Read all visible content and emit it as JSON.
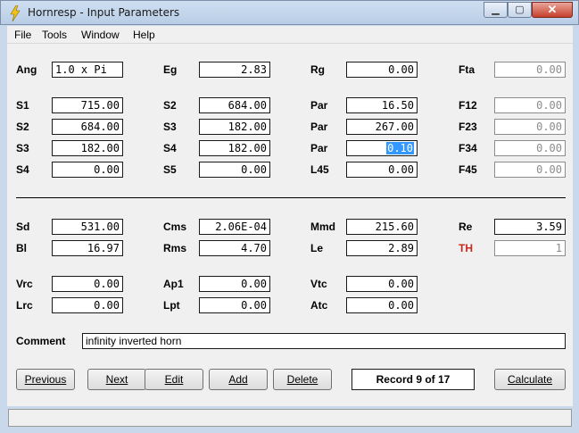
{
  "window": {
    "title": "Hornresp - Input Parameters",
    "min": "▁",
    "max": "▢",
    "close": "✕"
  },
  "menu": [
    "File",
    "Tools",
    "Window",
    "Help"
  ],
  "params": {
    "ang": {
      "label": "Ang",
      "value": "1.0 x Pi"
    },
    "eg": {
      "label": "Eg",
      "value": "2.83"
    },
    "rg": {
      "label": "Rg",
      "value": "0.00"
    },
    "fta": {
      "label": "Fta",
      "value": "0.00"
    },
    "s1": {
      "label": "S1",
      "value": "715.00"
    },
    "s2a": {
      "label": "S2",
      "value": "684.00"
    },
    "par1": {
      "label": "Par",
      "value": "16.50"
    },
    "f12": {
      "label": "F12",
      "value": "0.00"
    },
    "s2b": {
      "label": "S2",
      "value": "684.00"
    },
    "s3a": {
      "label": "S3",
      "value": "182.00"
    },
    "par2": {
      "label": "Par",
      "value": "267.00"
    },
    "f23": {
      "label": "F23",
      "value": "0.00"
    },
    "s3b": {
      "label": "S3",
      "value": "182.00"
    },
    "s4a": {
      "label": "S4",
      "value": "182.00"
    },
    "par3": {
      "label": "Par",
      "value": "0.10"
    },
    "f34": {
      "label": "F34",
      "value": "0.00"
    },
    "s4b": {
      "label": "S4",
      "value": "0.00"
    },
    "s5": {
      "label": "S5",
      "value": "0.00"
    },
    "l45": {
      "label": "L45",
      "value": "0.00"
    },
    "f45": {
      "label": "F45",
      "value": "0.00"
    },
    "sd": {
      "label": "Sd",
      "value": "531.00"
    },
    "cms": {
      "label": "Cms",
      "value": "2.06E-04"
    },
    "mmd": {
      "label": "Mmd",
      "value": "215.60"
    },
    "re": {
      "label": "Re",
      "value": "3.59"
    },
    "bl": {
      "label": "Bl",
      "value": "16.97"
    },
    "rms": {
      "label": "Rms",
      "value": "4.70"
    },
    "le": {
      "label": "Le",
      "value": "2.89"
    },
    "th": {
      "label": "TH",
      "value": "1"
    },
    "vrc": {
      "label": "Vrc",
      "value": "0.00"
    },
    "ap1": {
      "label": "Ap1",
      "value": "0.00"
    },
    "vtc": {
      "label": "Vtc",
      "value": "0.00"
    },
    "lrc": {
      "label": "Lrc",
      "value": "0.00"
    },
    "lpt": {
      "label": "Lpt",
      "value": "0.00"
    },
    "atc": {
      "label": "Atc",
      "value": "0.00"
    }
  },
  "comment": {
    "label": "Comment",
    "value": "infinity inverted horn"
  },
  "buttons": {
    "previous": "Previous",
    "next": "Next",
    "edit": "Edit",
    "add": "Add",
    "delete": "Delete",
    "calculate": "Calculate"
  },
  "record": "Record 9 of 17",
  "colors": {
    "selection": "#3399ff",
    "th_label": "#c8281e"
  }
}
